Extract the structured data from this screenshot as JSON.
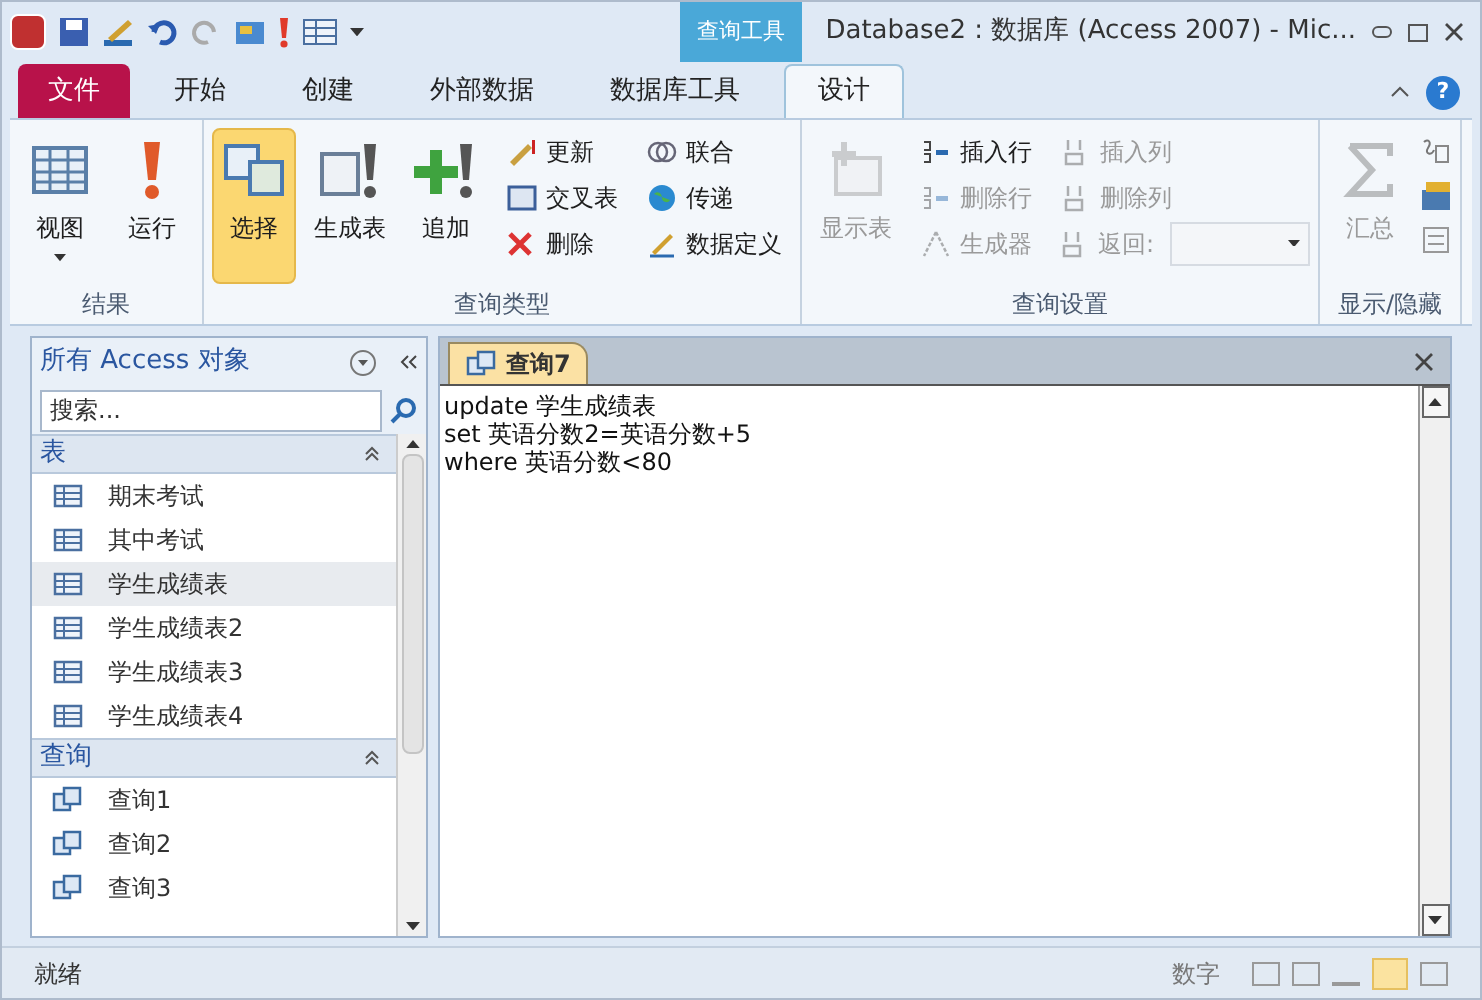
{
  "window": {
    "title": "Database2 : 数据库 (Access 2007) - Mic...",
    "context_tab": "查询工具",
    "help": "?"
  },
  "ribbon_tabs": [
    {
      "label": "文件",
      "kind": "file",
      "selected": false
    },
    {
      "label": "开始",
      "kind": "tab",
      "selected": false
    },
    {
      "label": "创建",
      "kind": "tab",
      "selected": false
    },
    {
      "label": "外部数据",
      "kind": "tab",
      "selected": false
    },
    {
      "label": "数据库工具",
      "kind": "tab",
      "selected": false
    },
    {
      "label": "设计",
      "kind": "tab",
      "selected": true
    }
  ],
  "ribbon_groups": [
    {
      "label": "结果",
      "buttons": [
        {
          "label": "视图",
          "kind": "large",
          "dropdown": true
        },
        {
          "label": "运行",
          "kind": "large",
          "dropdown": false
        }
      ]
    },
    {
      "label": "查询类型",
      "buttons": [
        {
          "label": "选择",
          "kind": "large",
          "selected": true
        },
        {
          "label": "生成表",
          "kind": "large",
          "selected": false
        },
        {
          "label": "追加",
          "kind": "large",
          "selected": false
        },
        {
          "label": "更新",
          "kind": "small",
          "selected": false
        },
        {
          "label": "交叉表",
          "kind": "small",
          "selected": false
        },
        {
          "label": "删除",
          "kind": "small",
          "selected": false
        },
        {
          "label": "联合",
          "kind": "small",
          "selected": false
        },
        {
          "label": "传递",
          "kind": "small",
          "selected": false
        },
        {
          "label": "数据定义",
          "kind": "small",
          "selected": false
        }
      ]
    },
    {
      "label": "查询设置",
      "buttons": [
        {
          "label": "显示表",
          "kind": "large",
          "disabled": true
        },
        {
          "label": "插入行",
          "kind": "small",
          "disabled": false
        },
        {
          "label": "删除行",
          "kind": "small",
          "disabled": true
        },
        {
          "label": "生成器",
          "kind": "small",
          "disabled": true
        },
        {
          "label": "插入列",
          "kind": "small",
          "disabled": true
        },
        {
          "label": "删除列",
          "kind": "small",
          "disabled": true
        },
        {
          "label": "返回:",
          "kind": "combo",
          "disabled": true
        }
      ]
    },
    {
      "label": "显示/隐藏",
      "buttons": [
        {
          "label": "汇总",
          "kind": "large",
          "disabled": true
        }
      ]
    }
  ],
  "nav": {
    "title": "所有 Access 对象",
    "search_placeholder": "搜索...",
    "groups": [
      {
        "label": "表",
        "kind": "table",
        "expanded": true,
        "items": [
          {
            "label": "期末考试",
            "selected": false
          },
          {
            "label": "其中考试",
            "selected": false
          },
          {
            "label": "学生成绩表",
            "selected": true
          },
          {
            "label": "学生成绩表2",
            "selected": false
          },
          {
            "label": "学生成绩表3",
            "selected": false
          },
          {
            "label": "学生成绩表4",
            "selected": false
          }
        ]
      },
      {
        "label": "查询",
        "kind": "query",
        "expanded": true,
        "items": [
          {
            "label": "查询1",
            "selected": false
          },
          {
            "label": "查询2",
            "selected": false
          },
          {
            "label": "查询3",
            "selected": false
          }
        ]
      }
    ]
  },
  "document": {
    "tab": "查询7",
    "sql_lines": [
      "update 学生成绩表",
      "set 英语分数2=英语分数+5",
      "where 英语分数<80"
    ]
  },
  "status_bar": {
    "left": "就绪",
    "right": "数字"
  }
}
